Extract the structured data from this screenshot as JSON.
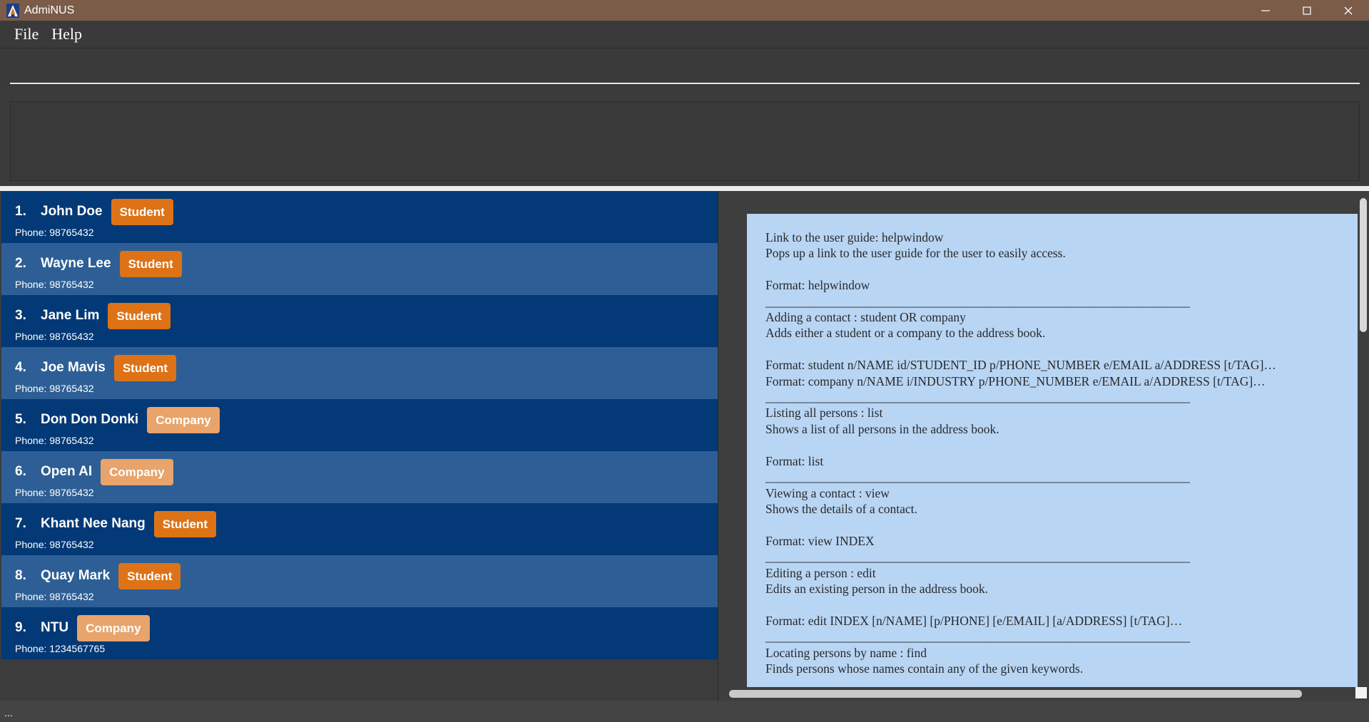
{
  "window": {
    "title": "AdmiNUS",
    "controls": {
      "minimize": "─",
      "maximize": "☐",
      "close": "✕"
    }
  },
  "menu": {
    "items": [
      "File",
      "Help"
    ]
  },
  "command": {
    "value": "",
    "placeholder": ""
  },
  "result": {
    "text": ""
  },
  "persons": [
    {
      "index": "1.",
      "name": "John Doe",
      "tag": "Student",
      "tag_type": "student",
      "phone": "Phone: 98765432"
    },
    {
      "index": "2.",
      "name": "Wayne Lee",
      "tag": "Student",
      "tag_type": "student",
      "phone": "Phone: 98765432"
    },
    {
      "index": "3.",
      "name": "Jane Lim",
      "tag": "Student",
      "tag_type": "student",
      "phone": "Phone: 98765432"
    },
    {
      "index": "4.",
      "name": "Joe Mavis",
      "tag": "Student",
      "tag_type": "student",
      "phone": "Phone: 98765432"
    },
    {
      "index": "5.",
      "name": "Don Don Donki",
      "tag": "Company",
      "tag_type": "company",
      "phone": "Phone: 98765432"
    },
    {
      "index": "6.",
      "name": "Open AI",
      "tag": "Company",
      "tag_type": "company",
      "phone": "Phone: 98765432"
    },
    {
      "index": "7.",
      "name": "Khant Nee Nang",
      "tag": "Student",
      "tag_type": "student",
      "phone": "Phone: 98765432"
    },
    {
      "index": "8.",
      "name": "Quay Mark",
      "tag": "Student",
      "tag_type": "student",
      "phone": "Phone: 98765432"
    },
    {
      "index": "9.",
      "name": "NTU",
      "tag": "Company",
      "tag_type": "company",
      "phone": "Phone: 1234567765"
    }
  ],
  "help_text": "Link to the user guide: helpwindow\nPops up a link to the user guide for the user to easily access.\n\nFormat: helpwindow\n____________________________________________________________________\nAdding a contact : student OR company\nAdds either a student or a company to the address book.\n\nFormat: student n/NAME id/STUDENT_ID p/PHONE_NUMBER e/EMAIL a/ADDRESS [t/TAG]…\nFormat: company n/NAME i/INDUSTRY p/PHONE_NUMBER e/EMAIL a/ADDRESS [t/TAG]…\n____________________________________________________________________\nListing all persons : list\nShows a list of all persons in the address book.\n\nFormat: list\n____________________________________________________________________\nViewing a contact : view\nShows the details of a contact.\n\nFormat: view INDEX\n____________________________________________________________________\nEditing a person : edit\nEdits an existing person in the address book.\n\nFormat: edit INDEX [n/NAME] [p/PHONE] [e/EMAIL] [a/ADDRESS] [t/TAG]…\n____________________________________________________________________\nLocating persons by name : find\nFinds persons whose names contain any of the given keywords.",
  "status": {
    "text": "..."
  },
  "colors": {
    "titlebar": "#7a5c49",
    "card_dark": "#023976",
    "card_light": "#2d5f96",
    "tag_student": "#dd7316",
    "tag_company": "#e8a46a",
    "help_bg": "#b8d5f4"
  }
}
